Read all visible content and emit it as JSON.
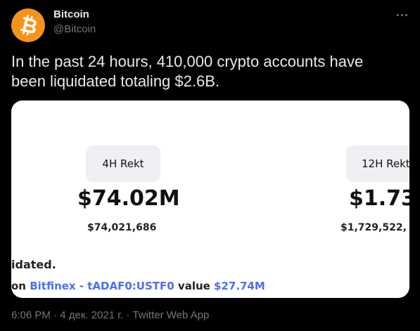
{
  "author": {
    "display_name": "Bitcoin",
    "handle": "@Bitcoin",
    "avatar_icon": "bitcoin-logo-icon",
    "avatar_color": "#F7931A"
  },
  "tweet": {
    "text_line1": "In the past 24 hours, 410,000 crypto accounts have",
    "text_line2": "been liquidated totaling $2.6B."
  },
  "media": {
    "panel_4h": {
      "label": "4H Rekt",
      "big_value": "$74.02M",
      "exact_value": "$74,021,686"
    },
    "panel_12h": {
      "label": "12H Rekt",
      "big_value": "$1.73",
      "exact_value": "$1,729,522,"
    },
    "liquidated_text": "idated.",
    "detail": {
      "prefix": "on ",
      "exchange": "Bitfinex",
      "separator": " - ",
      "pair": "tADAF0:USTF0",
      "value_label": " value ",
      "value": "$27.74M"
    }
  },
  "meta": {
    "time": "6:06 PM",
    "dot1": " · ",
    "date": "4 дек. 2021 г.",
    "dot2": " · ",
    "source": "Twitter Web App"
  },
  "colors": {
    "background": "#000000",
    "primary_text": "#e7e9ea",
    "secondary_text": "#71767b",
    "link_blue": "#4c6ef5",
    "bitcoin_orange": "#F7931A"
  }
}
